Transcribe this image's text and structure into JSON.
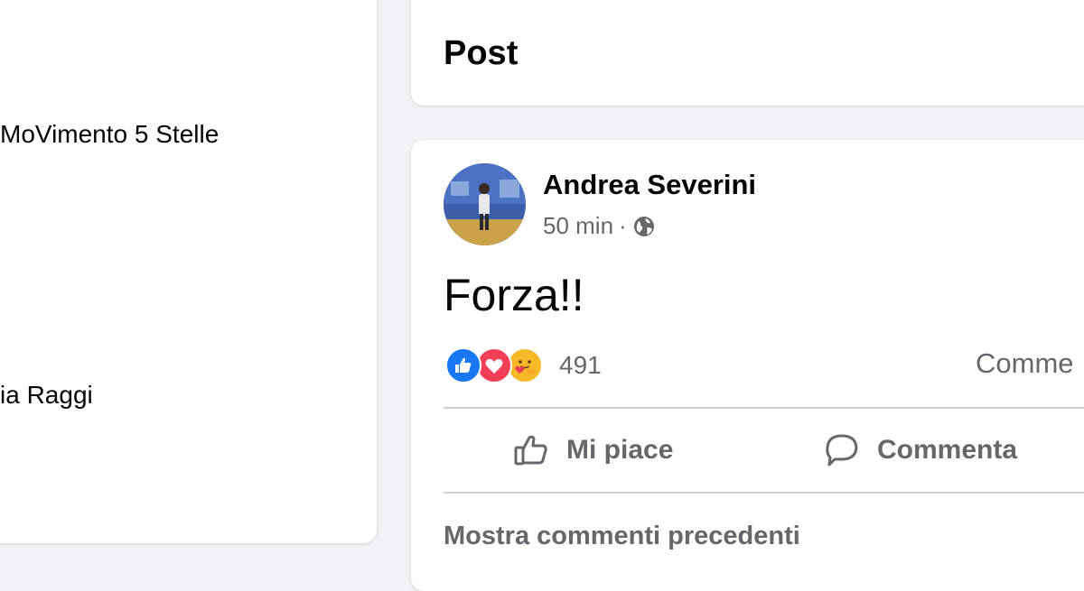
{
  "left_panel": {
    "line1": "MoVimento 5 Stelle",
    "line2": "ia Raggi"
  },
  "header": {
    "title": "Post"
  },
  "post": {
    "author": "Andrea Severini",
    "time": "50 min",
    "separator": "·",
    "privacy_icon": "globe-icon",
    "text": "Forza!!",
    "reactions": {
      "icons": [
        "like-reaction-icon",
        "love-reaction-icon",
        "care-reaction-icon"
      ],
      "count": "491"
    },
    "comments_label": "Comme",
    "actions": {
      "like_label": "Mi piace",
      "comment_label": "Commenta"
    },
    "show_previous_comments": "Mostra commenti precedenti"
  },
  "colors": {
    "background": "#f0f2f5",
    "card": "#ffffff",
    "primary_text": "#050505",
    "secondary_text": "#65676b",
    "like_blue": "#1877f2",
    "love_red": "#f33e58",
    "care_yellow": "#f7b928"
  }
}
